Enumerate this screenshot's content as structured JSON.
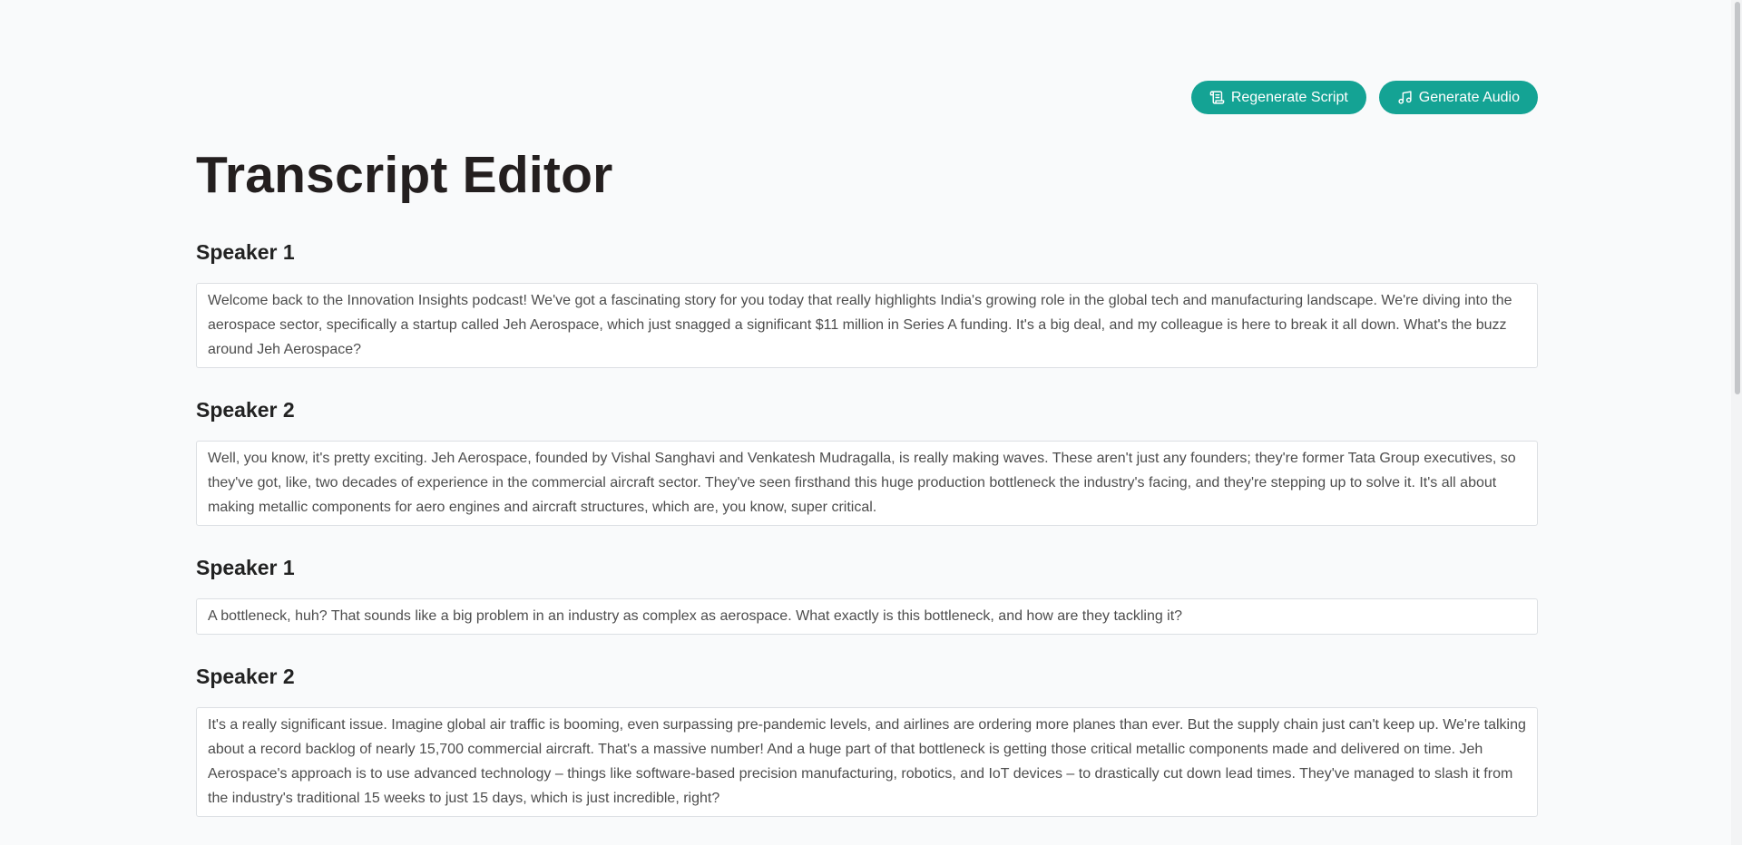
{
  "header": {
    "regenerate_label": "Regenerate Script",
    "regenerate_icon": "scroll-icon",
    "generate_audio_label": "Generate Audio",
    "generate_audio_icon": "music-note-icon",
    "title": "Transcript Editor"
  },
  "colors": {
    "accent": "#14a394",
    "background": "#f9fafb",
    "textbox_border": "#dcdfe3"
  },
  "segments": [
    {
      "speaker": "Speaker 1",
      "text": "Welcome back to the Innovation Insights podcast! We've got a fascinating story for you today that really highlights India's growing role in the global tech and manufacturing landscape. We're diving into the aerospace sector, specifically a startup called Jeh Aerospace, which just snagged a significant $11 million in Series A funding. It's a big deal, and my colleague is here to break it all down. What's the buzz around Jeh Aerospace?"
    },
    {
      "speaker": "Speaker 2",
      "text": "Well, you know, it's pretty exciting. Jeh Aerospace, founded by Vishal Sanghavi and Venkatesh Mudragalla, is really making waves. These aren't just any founders; they're former Tata Group executives, so they've got, like, two decades of experience in the commercial aircraft sector. They've seen firsthand this huge production bottleneck the industry's facing, and they're stepping up to solve it. It's all about making metallic components for aero engines and aircraft structures, which are, you know, super critical."
    },
    {
      "speaker": "Speaker 1",
      "text": "A bottleneck, huh? That sounds like a big problem in an industry as complex as aerospace. What exactly is this bottleneck, and how are they tackling it?"
    },
    {
      "speaker": "Speaker 2",
      "text": "It's a really significant issue. Imagine global air traffic is booming, even surpassing pre-pandemic levels, and airlines are ordering more planes than ever. But the supply chain just can't keep up. We're talking about a record backlog of nearly 15,700 commercial aircraft. That's a massive number! And a huge part of that bottleneck is getting those critical metallic components made and delivered on time. Jeh Aerospace's approach is to use advanced technology – things like software-based precision manufacturing, robotics, and IoT devices – to drastically cut down lead times. They've managed to slash it from the industry's traditional 15 weeks to just 15 days, which is just incredible, right?"
    }
  ]
}
